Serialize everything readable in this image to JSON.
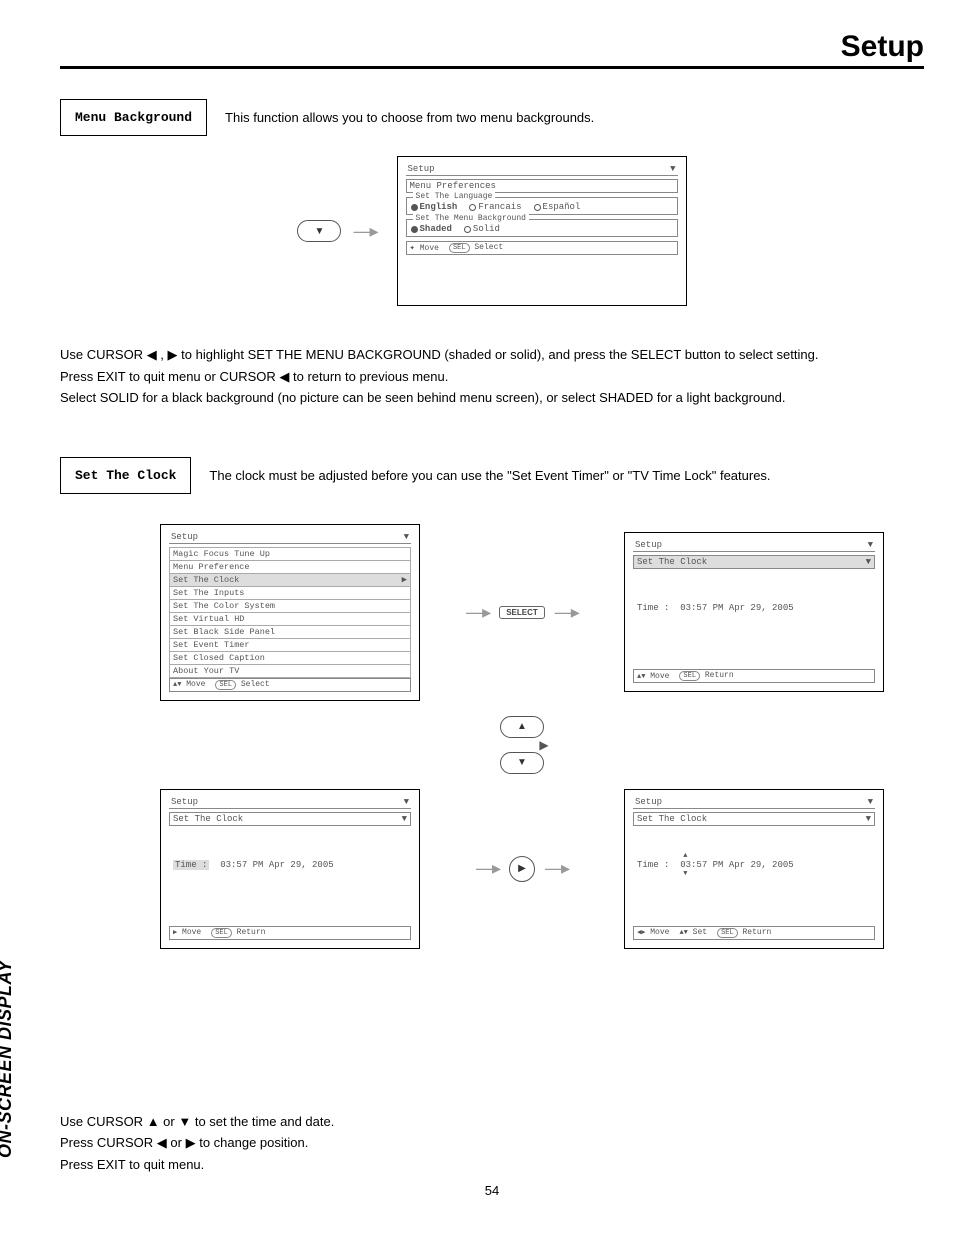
{
  "header": {
    "title": "Setup"
  },
  "section1": {
    "callout": "Menu Background",
    "intro": "This function allows you to choose from two menu backgrounds."
  },
  "osd1": {
    "title": "Setup",
    "sub": "Menu Preferences",
    "group_lang": "Set The Language",
    "lang_opts": [
      "English",
      "Francais",
      "Español"
    ],
    "group_bg": "Set The Menu Background",
    "bg_opts": [
      "Shaded",
      "Solid"
    ],
    "foot_move": "Move",
    "foot_sel": "Select",
    "sel_label": "SEL"
  },
  "para1": {
    "l1_a": "Use CURSOR ",
    "l1_b": " , ",
    "l1_c": " to highlight SET THE MENU BACKGROUND (shaded or solid), and press the SELECT button to select setting.",
    "l2_a": "Press EXIT to quit menu or CURSOR ",
    "l2_b": " to return to previous menu.",
    "l3": "Select SOLID for a black background (no picture can be seen behind menu screen), or select SHADED for a light background."
  },
  "section2": {
    "callout": "Set The Clock",
    "intro": "The clock must be adjusted before you can use the \"Set Event Timer\" or \"TV Time Lock\" features."
  },
  "osd2a": {
    "title": "Setup",
    "items": [
      "Magic Focus Tune Up",
      "Menu Preference",
      "Set The Clock",
      "Set The Inputs",
      "Set The Color System",
      "Set Virtual HD",
      "Set Black Side Panel",
      "Set Event Timer",
      "Set Closed Caption",
      "About Your TV"
    ],
    "foot_move": "Move",
    "foot_sel": "Select"
  },
  "select_chip": "SELECT",
  "osd2b": {
    "title": "Setup",
    "sub": "Set The Clock",
    "time_label": "Time :",
    "time_val": "03:57 PM Apr 29, 2005",
    "foot_move": "Move",
    "foot_ret": "Return"
  },
  "osd2c": {
    "title": "Setup",
    "sub": "Set The Clock",
    "time_label": "Time :",
    "time_val": "03:57 PM Apr 29, 2005",
    "foot_move": "Move",
    "foot_ret": "Return"
  },
  "osd2d": {
    "title": "Setup",
    "sub": "Set The Clock",
    "time_label": "Time :",
    "time_val_seg1": "03",
    "time_val_seg_rest": ":57 PM Apr 29, 2005",
    "foot_move": "Move",
    "foot_set": "Set",
    "foot_ret": "Return"
  },
  "para2": {
    "l1_a": "Use CURSOR ",
    "l1_b": " or ",
    "l1_c": " to set the time and date.",
    "l2_a": "Press CURSOR ",
    "l2_b": " or ",
    "l2_c": " to change position.",
    "l3": "Press EXIT to quit menu."
  },
  "sidebar": "ON-SCREEN DISPLAY",
  "page_number": "54",
  "glyphs": {
    "left": "◀",
    "right": "▶",
    "up": "▲",
    "down": "▼",
    "updown": "▲▼",
    "leftright": "◀▶",
    "diamond": "✦"
  }
}
